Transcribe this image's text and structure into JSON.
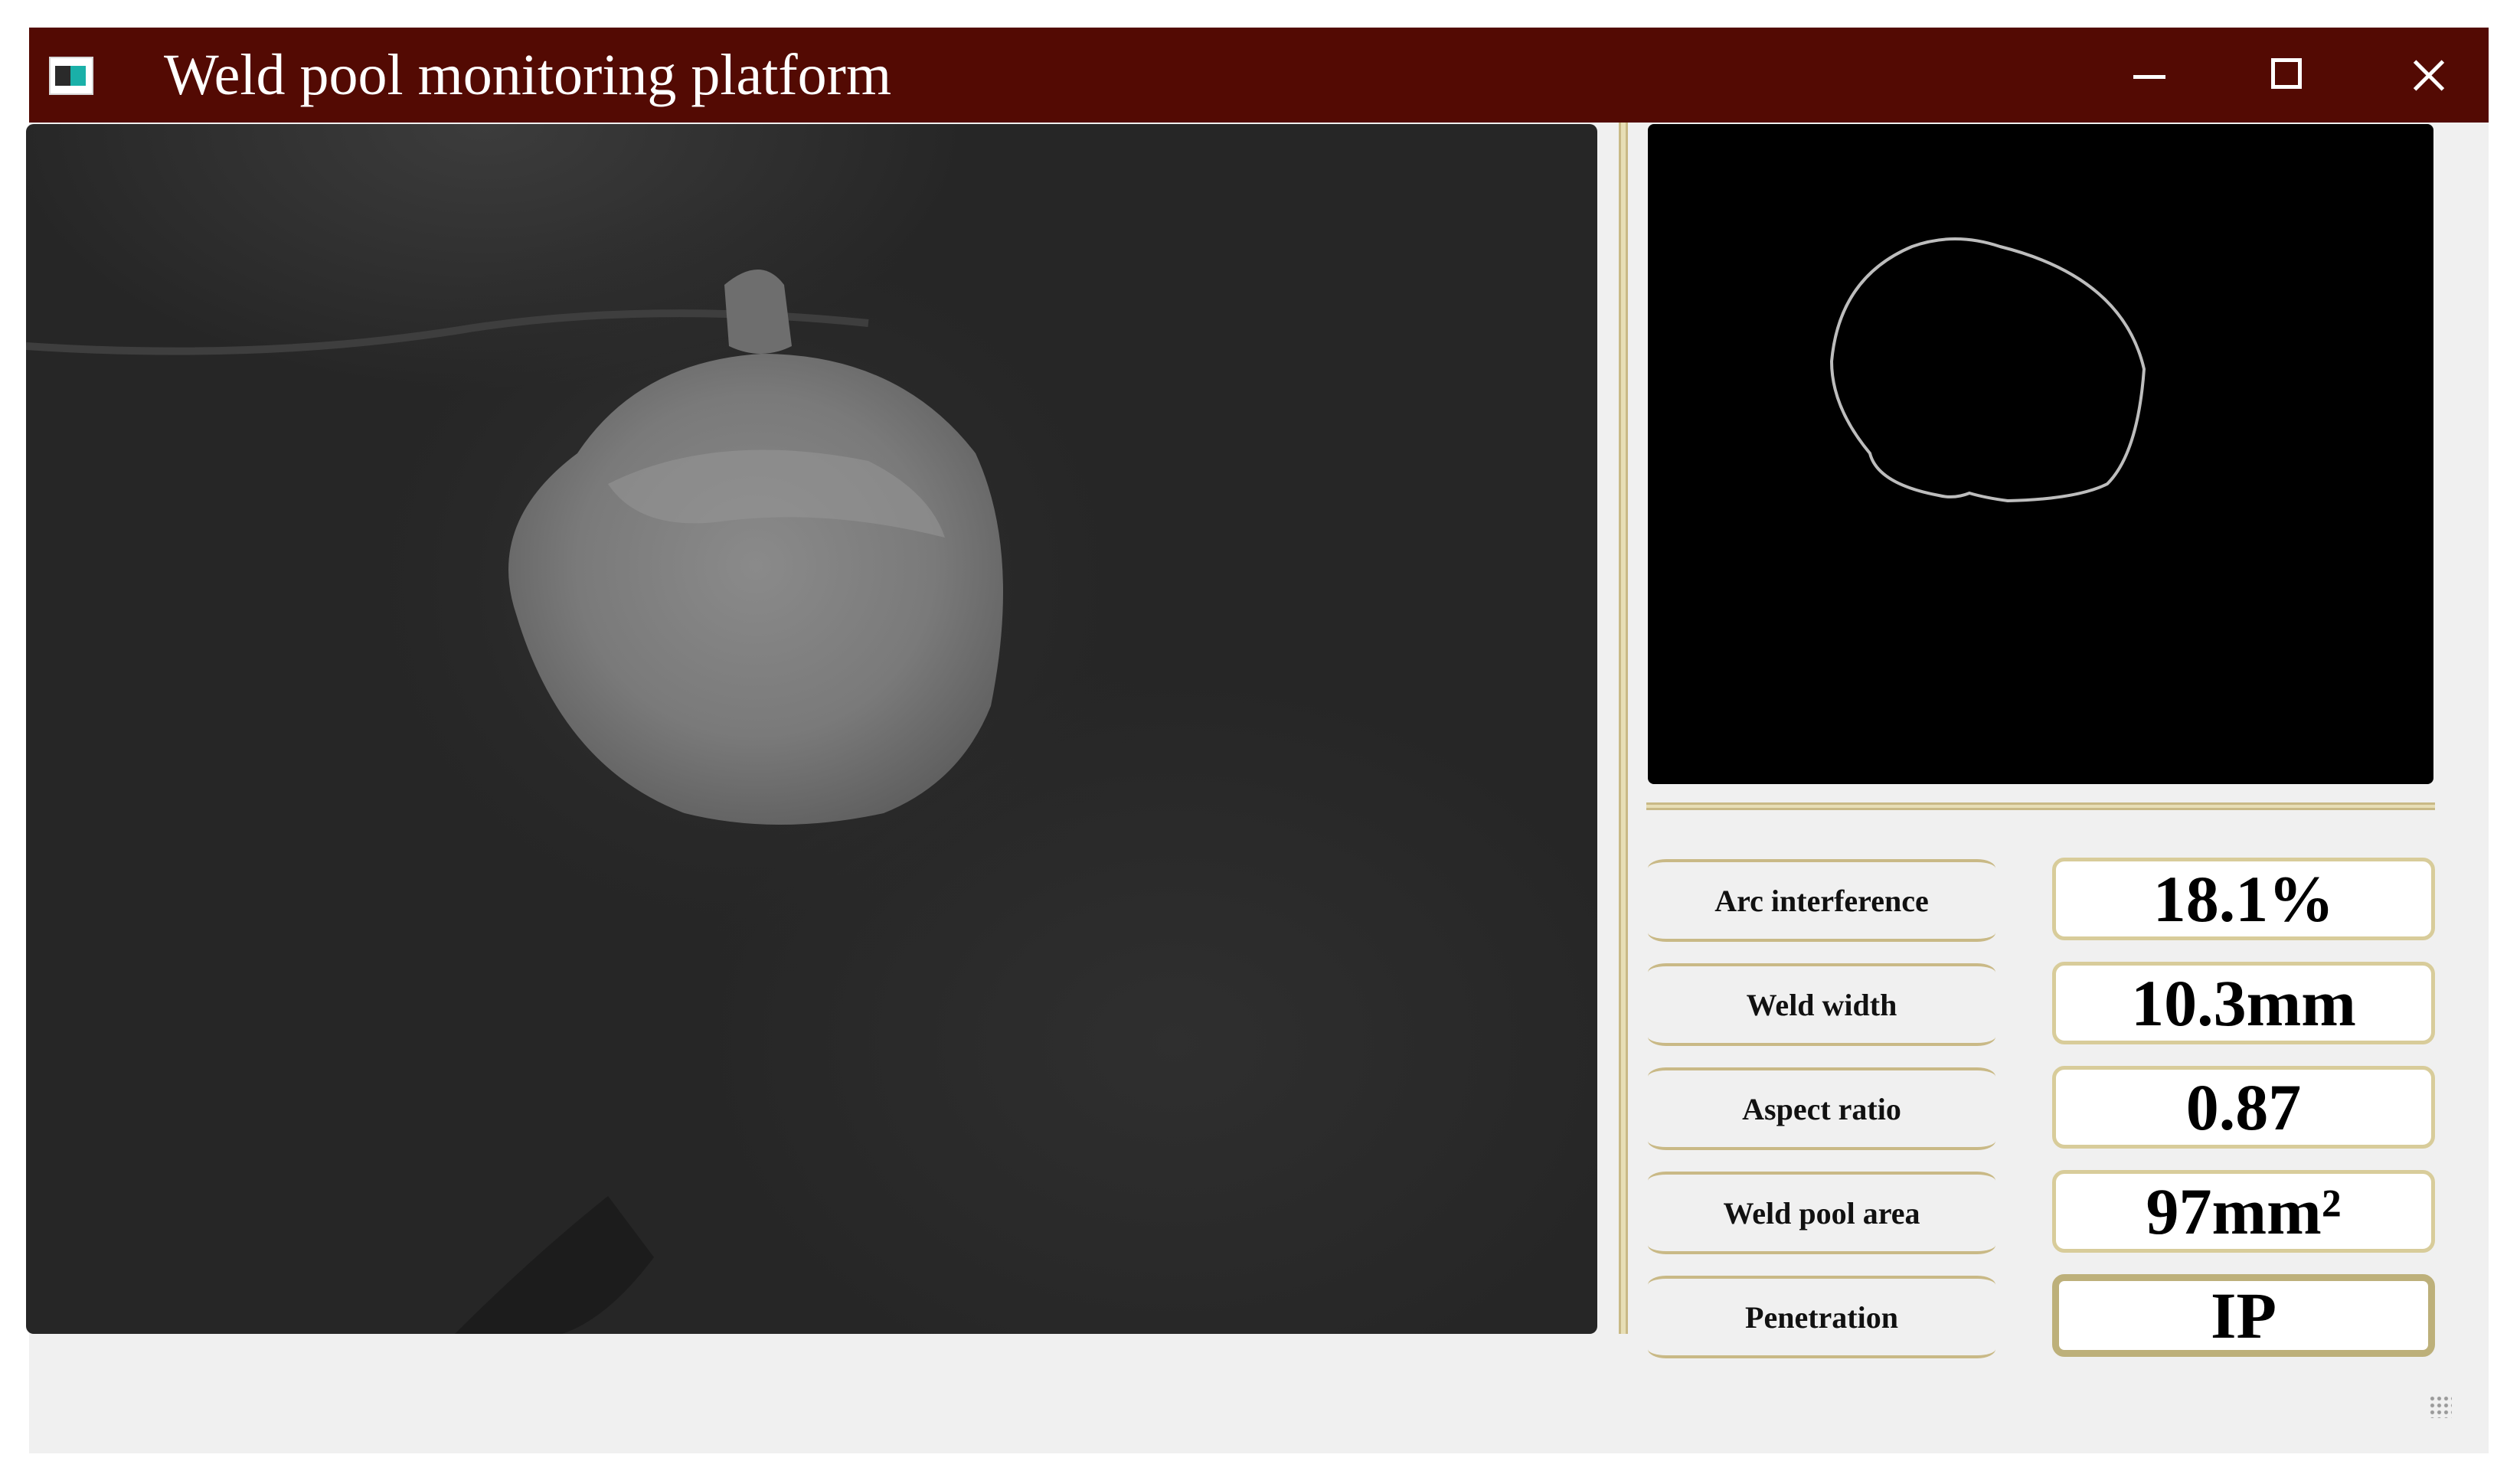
{
  "window": {
    "title": "Weld pool monitoring platform",
    "icons": {
      "app": "app-icon",
      "minimize": "minimize-icon",
      "maximize": "maximize-icon",
      "close": "close-icon"
    },
    "colors": {
      "titlebar": "#530a03",
      "panel_border": "#c9b986",
      "background": "#f0f0f0"
    }
  },
  "views": {
    "camera": "grayscale weld pool camera image",
    "contour": "extracted weld pool contour"
  },
  "metrics": [
    {
      "label": "Arc interference",
      "value": "18.1%"
    },
    {
      "label": "Weld width",
      "value": "10.3mm"
    },
    {
      "label": "Aspect ratio",
      "value": "0.87"
    },
    {
      "label": "Weld pool area",
      "value": "97mm²"
    },
    {
      "label": "Penetration",
      "value": "IP"
    }
  ]
}
